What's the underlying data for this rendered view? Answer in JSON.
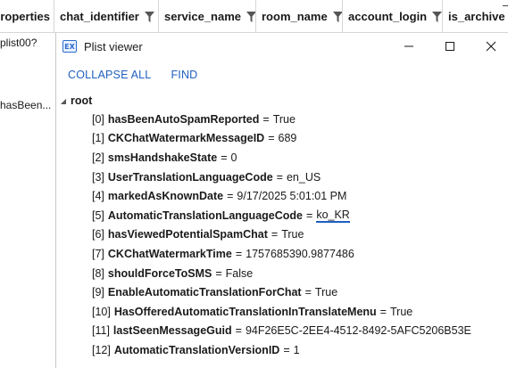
{
  "grid": {
    "columns": [
      {
        "label": "roperties",
        "filter": false
      },
      {
        "label": "chat_identifier",
        "filter": true
      },
      {
        "label": "service_name",
        "filter": true
      },
      {
        "label": "room_name",
        "filter": true
      },
      {
        "label": "account_login",
        "filter": true
      },
      {
        "label": "is_archive",
        "filter": false
      }
    ],
    "cells": [
      "plist00?",
      "hasBeen..."
    ]
  },
  "window": {
    "icon_text": "EX",
    "title": "Plist viewer",
    "buttons": {
      "minimize": "—",
      "maximize": "☐",
      "close": "✕"
    }
  },
  "toolbar": {
    "collapse_all": "COLLAPSE ALL",
    "find": "FIND"
  },
  "tree": {
    "caret": "◢",
    "root": "root",
    "items": [
      {
        "idx": "[0]",
        "key": "hasBeenAutoSpamReported",
        "value": "True"
      },
      {
        "idx": "[1]",
        "key": "CKChatWatermarkMessageID",
        "value": "689"
      },
      {
        "idx": "[2]",
        "key": "smsHandshakeState",
        "value": "0"
      },
      {
        "idx": "[3]",
        "key": "UserTranslationLanguageCode",
        "value": "en_US"
      },
      {
        "idx": "[4]",
        "key": "markedAsKnownDate",
        "value": "9/17/2025 5:01:01 PM"
      },
      {
        "idx": "[5]",
        "key": "AutomaticTranslationLanguageCode",
        "value": "ko_KR",
        "highlighted": true
      },
      {
        "idx": "[6]",
        "key": "hasViewedPotentialSpamChat",
        "value": "True"
      },
      {
        "idx": "[7]",
        "key": "CKChatWatermarkTime",
        "value": "1757685390.9877486"
      },
      {
        "idx": "[8]",
        "key": "shouldForceToSMS",
        "value": "False"
      },
      {
        "idx": "[9]",
        "key": "EnableAutomaticTranslationForChat",
        "value": "True"
      },
      {
        "idx": "[10]",
        "key": "HasOfferedAutomaticTranslationInTranslateMenu",
        "value": "True"
      },
      {
        "idx": "[11]",
        "key": "lastSeenMessageGuid",
        "value": "94F26E5C-2EE4-4512-8492-5AFC5206B53E"
      },
      {
        "idx": "[12]",
        "key": "AutomaticTranslationVersionID",
        "value": "1"
      }
    ]
  },
  "colors": {
    "accent": "#1f5fbf",
    "underline": "#1f5fbf"
  }
}
